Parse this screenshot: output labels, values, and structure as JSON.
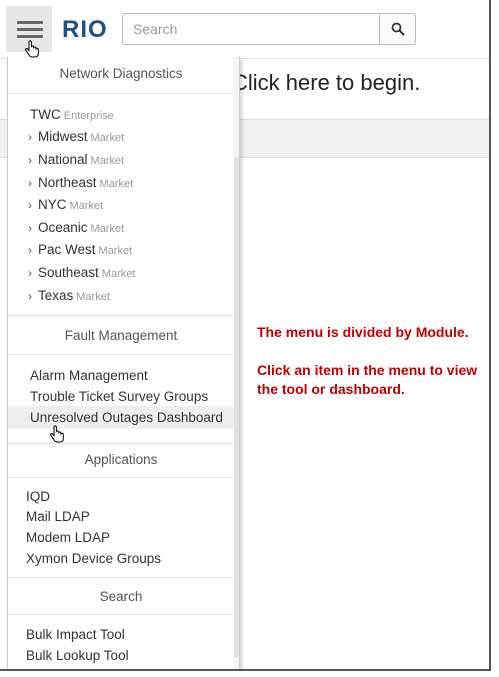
{
  "header": {
    "logo": "RIO",
    "search_placeholder": "Search"
  },
  "main": {
    "title": "Click here to begin."
  },
  "menu": {
    "network": {
      "heading": "Network Diagnostics",
      "root": {
        "label": "TWC",
        "tag": "Enterprise"
      },
      "items": [
        {
          "label": "Midwest",
          "tag": "Market"
        },
        {
          "label": "National",
          "tag": "Market"
        },
        {
          "label": "Northeast",
          "tag": "Market"
        },
        {
          "label": "NYC",
          "tag": "Market"
        },
        {
          "label": "Oceanic",
          "tag": "Market"
        },
        {
          "label": "Pac West",
          "tag": "Market"
        },
        {
          "label": "Southeast",
          "tag": "Market"
        },
        {
          "label": "Texas",
          "tag": "Market"
        }
      ]
    },
    "fault": {
      "heading": "Fault Management",
      "items": [
        "Alarm Management",
        "Trouble Ticket Survey Groups",
        "Unresolved Outages Dashboard"
      ]
    },
    "applications": {
      "heading": "Applications",
      "items": [
        "IQD",
        "Mail LDAP",
        "Modem LDAP",
        "Xymon Device Groups"
      ]
    },
    "search": {
      "heading": "Search",
      "items": [
        "Bulk Impact Tool",
        "Bulk Lookup Tool"
      ]
    }
  },
  "annotation": {
    "line1": "The menu is divided by Module.",
    "line2": "Click an item in the menu to view the tool or dashboard."
  },
  "icons": {
    "menu": "hamburger-icon",
    "search": "magnifier-icon",
    "chevron": "chevron-right-icon",
    "pointer": "hand-pointer-icon"
  },
  "colors": {
    "logo": "#1e4e8c",
    "annotation": "#c00000",
    "highlight": "#eeeeee"
  }
}
